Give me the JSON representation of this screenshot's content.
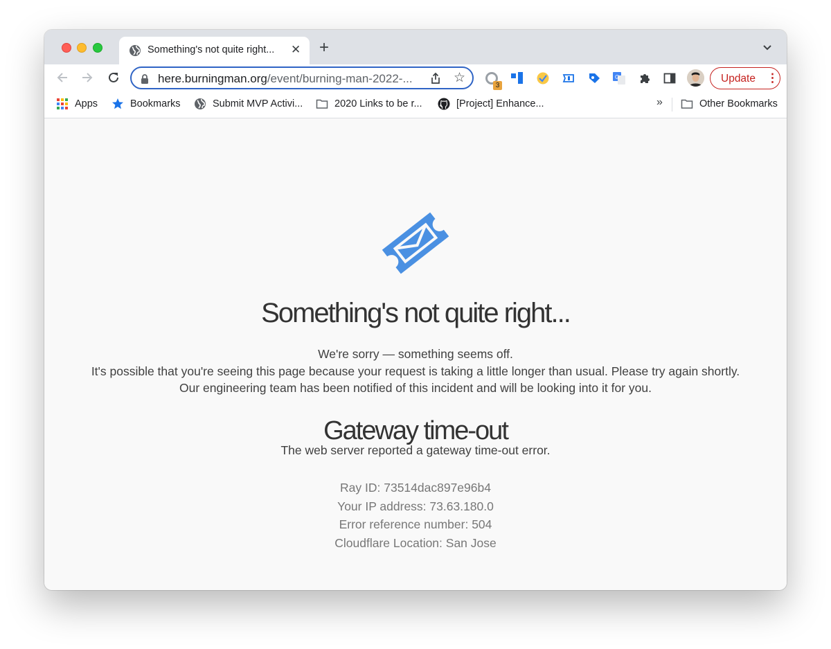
{
  "browser": {
    "tab": {
      "title": "Something's not quite right..."
    },
    "omnibox": {
      "domain": "here.burningman.org",
      "path": "/event/burning-man-2022-..."
    },
    "extensions": {
      "badge_count": "3"
    },
    "update_label": "Update",
    "bookmarks": [
      {
        "label": "Apps",
        "icon": "apps-grid-icon"
      },
      {
        "label": "Bookmarks",
        "icon": "star-icon"
      },
      {
        "label": "Submit MVP Activi...",
        "icon": "globe-icon"
      },
      {
        "label": "2020 Links to be r...",
        "icon": "folder-icon"
      },
      {
        "label": "[Project] Enhance...",
        "icon": "github-icon"
      }
    ],
    "other_bookmarks": "Other Bookmarks",
    "overflow": "»"
  },
  "page": {
    "headline": "Something's not quite right...",
    "message_lines": [
      "We're sorry — something seems off.",
      "It's possible that you're seeing this page because your request is taking a little longer than usual. Please try again shortly.",
      "Our engineering team has been notified of this incident and will be looking into it for you."
    ],
    "error_title": "Gateway time-out",
    "error_description": "The web server reported a gateway time-out error.",
    "details": [
      "Ray ID: 73514dac897e96b4",
      "Your IP address: 73.63.180.0",
      "Error reference number: 504",
      "Cloudflare Location: San Jose"
    ]
  },
  "colors": {
    "accent": "#4a90e2",
    "omnibox_border": "#2f64c5",
    "update": "#c5221f"
  }
}
